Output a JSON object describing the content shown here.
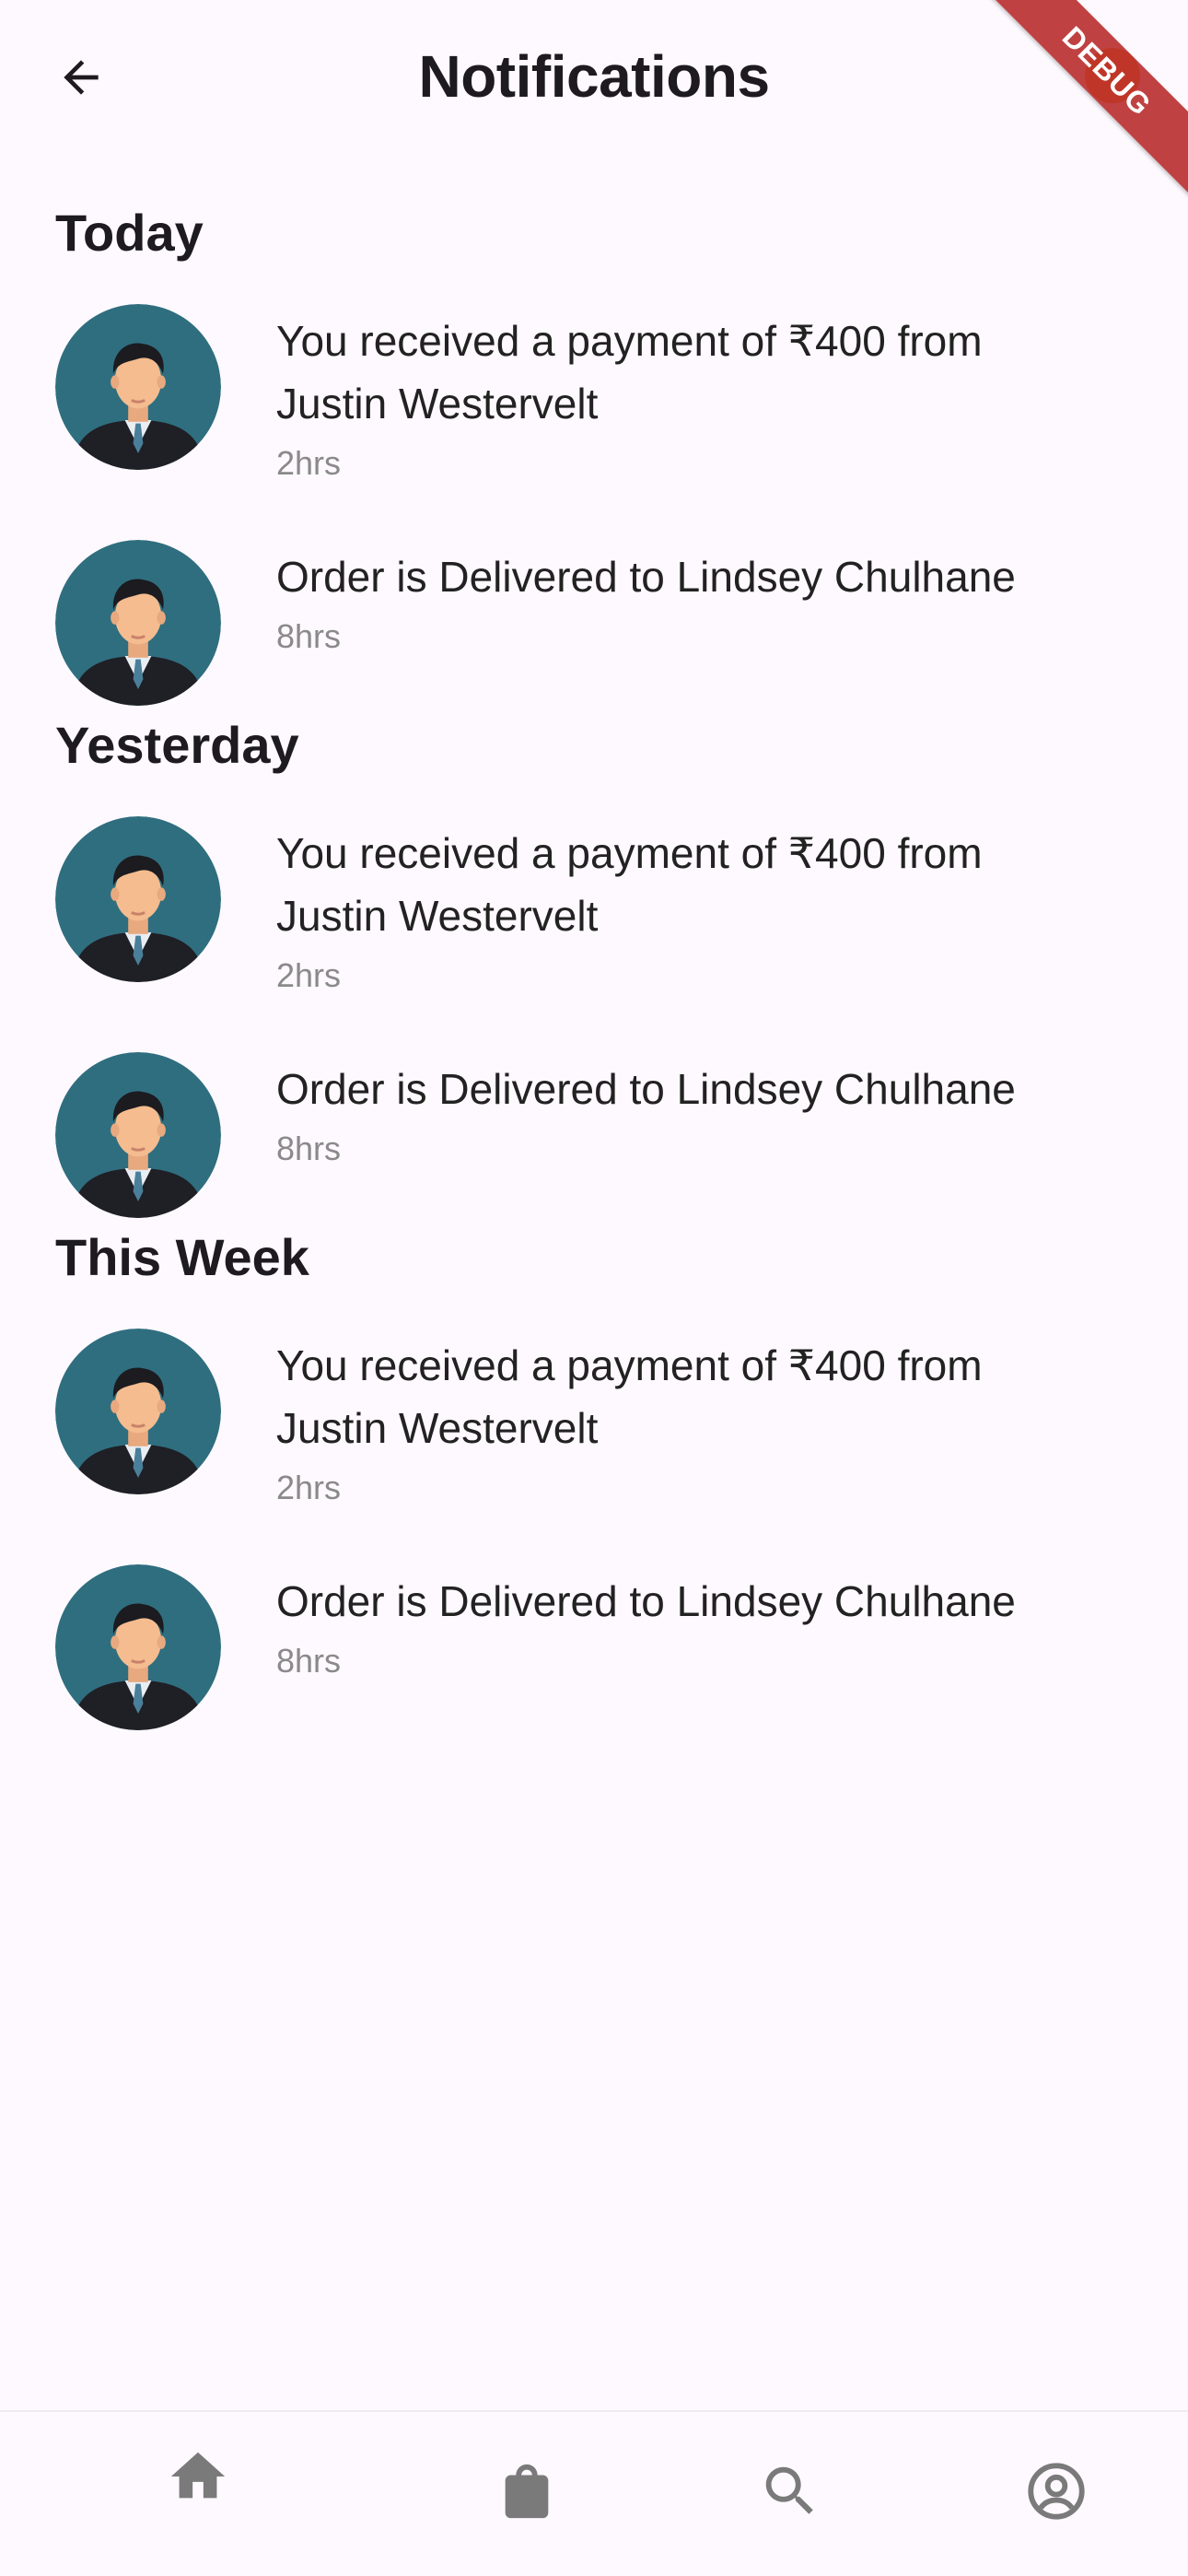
{
  "header": {
    "title": "Notifications",
    "debug_label": "DEBUG",
    "back_icon": "arrow-left-icon"
  },
  "sections": [
    {
      "title": "Today",
      "items": [
        {
          "message": "You received a payment of ₹400 from Justin Westervelt",
          "time": "2hrs"
        },
        {
          "message": "Order is Delivered to Lindsey Chulhane",
          "time": "8hrs"
        }
      ]
    },
    {
      "title": "Yesterday",
      "items": [
        {
          "message": "You received a payment of ₹400 from Justin Westervelt",
          "time": "2hrs"
        },
        {
          "message": "Order is Delivered to Lindsey Chulhane",
          "time": "8hrs"
        }
      ]
    },
    {
      "title": "This Week",
      "items": [
        {
          "message": "You received a payment of ₹400 from Justin Westervelt",
          "time": "2hrs"
        },
        {
          "message": "Order is Delivered to Lindsey Chulhane",
          "time": "8hrs"
        }
      ]
    }
  ],
  "bottom_nav": {
    "items": [
      {
        "icon": "home-icon"
      },
      {
        "icon": "shopping-bag-icon"
      },
      {
        "icon": "search-icon"
      },
      {
        "icon": "account-circle-icon"
      }
    ]
  },
  "colors": {
    "background": "#fef9fe",
    "avatar_bg": "#2f6e7f",
    "icon_gray": "#7a7a7a",
    "time_gray": "#8a8a8a",
    "debug_banner": "#b72727",
    "action_icon": "#f0a233"
  }
}
